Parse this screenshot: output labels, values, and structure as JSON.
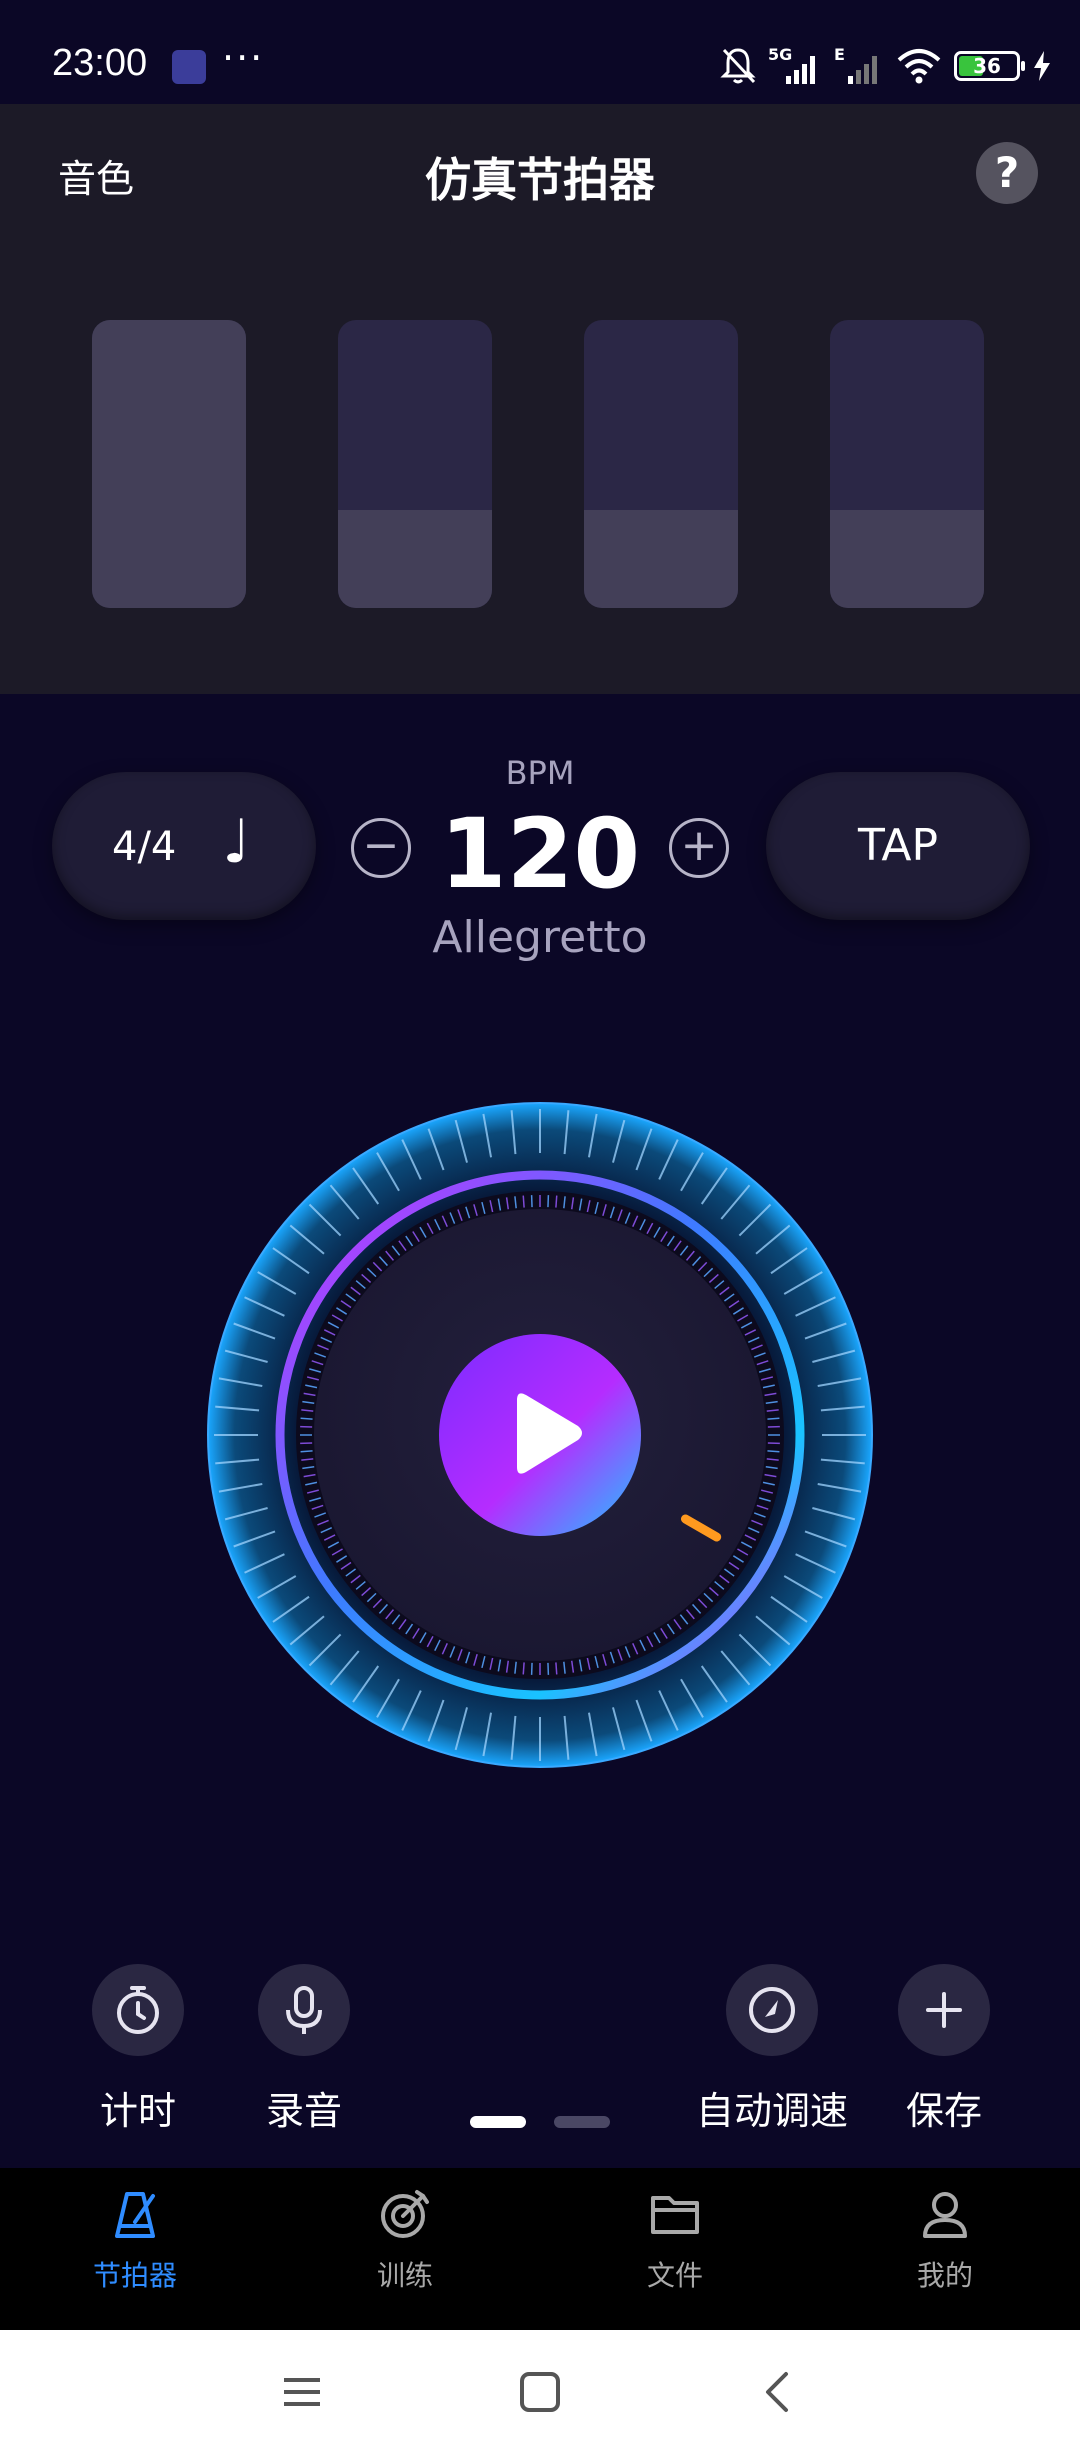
{
  "status_bar": {
    "time": "23:00",
    "dots": "···",
    "battery": "36",
    "icons": [
      "metronome-app-icon",
      "bell-off-icon",
      "signal-5g-icon",
      "signal-e-icon",
      "wifi-icon",
      "battery-icon",
      "charging-icon"
    ]
  },
  "header": {
    "left_label": "音色",
    "title": "仿真节拍器",
    "help": "?",
    "beats": [
      {
        "accent_fill": 1.0
      },
      {
        "accent_fill": 0.34
      },
      {
        "accent_fill": 0.34
      },
      {
        "accent_fill": 0.34
      }
    ]
  },
  "controls": {
    "time_signature": "4/4",
    "note_glyph": "♩",
    "bpm_label": "BPM",
    "bpm_value": "120",
    "tempo_name": "Allegretto",
    "minus": "−",
    "plus": "+",
    "tap_label": "TAP"
  },
  "actions": [
    {
      "label": "计时",
      "icon": "stopwatch-icon"
    },
    {
      "label": "录音",
      "icon": "microphone-icon"
    },
    {
      "label": "自动调速",
      "icon": "speed-gauge-icon"
    },
    {
      "label": "保存",
      "icon": "plus-icon"
    }
  ],
  "pager": {
    "pages": 2,
    "active": 0
  },
  "bottom_nav": [
    {
      "label": "节拍器",
      "icon": "metronome-icon",
      "active": true
    },
    {
      "label": "训练",
      "icon": "target-icon",
      "active": false
    },
    {
      "label": "文件",
      "icon": "folder-icon",
      "active": false
    },
    {
      "label": "我的",
      "icon": "profile-icon",
      "active": false
    }
  ],
  "colors": {
    "background": "#0b0726",
    "header_bg": "#1c1a27",
    "accent_blue": "#2f8cff",
    "dial_cyan": "#19c3ff",
    "dial_magenta": "#d32cff",
    "indicator_orange": "#ff9a1f"
  }
}
